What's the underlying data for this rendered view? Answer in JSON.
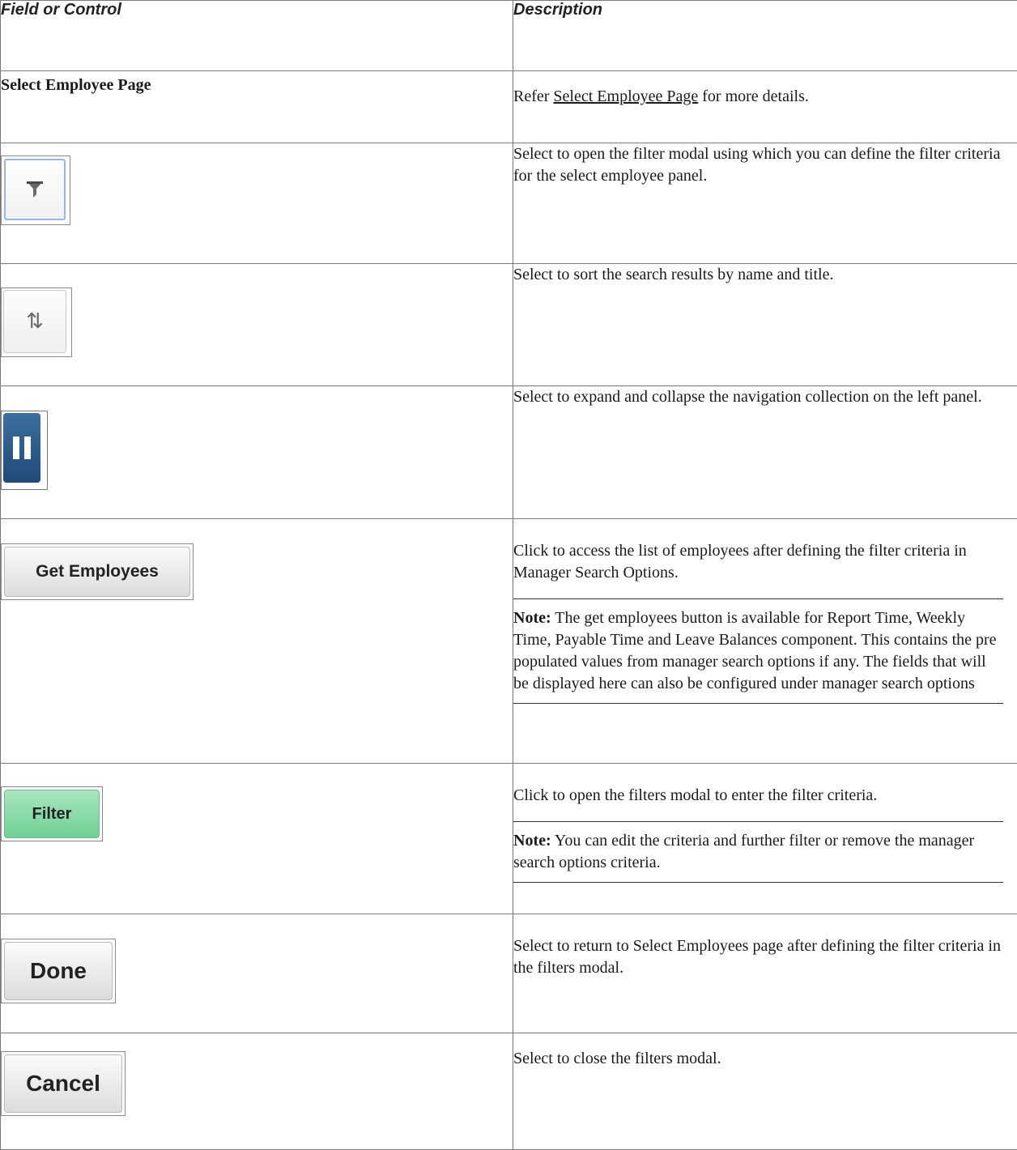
{
  "header": {
    "col1": "Field or Control",
    "col2": "Description"
  },
  "rows": [
    {
      "label": "Select Employee Page",
      "desc_prefix": "Refer ",
      "desc_link": "Select Employee Page",
      "desc_suffix": " for more details."
    },
    {
      "icon": "filter-icon",
      "desc": "Select to open the filter modal using which you can define the filter criteria for the select employee panel."
    },
    {
      "icon": "sort-icon",
      "glyph": "⇅",
      "desc": "Select to sort the search results by name and title."
    },
    {
      "icon": "pause-icon",
      "desc": "Select to expand and collapse the navigation collection on the left panel."
    },
    {
      "button": "Get Employees",
      "desc": "Click to access the list of employees after defining the filter criteria in Manager Search Options.",
      "note_label": "Note:",
      "note": " The get employees button is available for Report Time, Weekly Time, Payable Time and Leave Balances component. This contains the pre populated values from manager search options if any. The fields that will be displayed here can also be configured under manager search options"
    },
    {
      "button": "Filter",
      "desc": "Click to open the filters modal to enter the filter criteria.",
      "note_label": "Note:",
      "note": " You can edit the criteria and further filter or remove the manager search options criteria."
    },
    {
      "button": "Done",
      "desc": "Select to return to Select Employees page after defining the filter criteria in the filters modal."
    },
    {
      "button": "Cancel",
      "desc": "Select to close the filters modal."
    }
  ]
}
